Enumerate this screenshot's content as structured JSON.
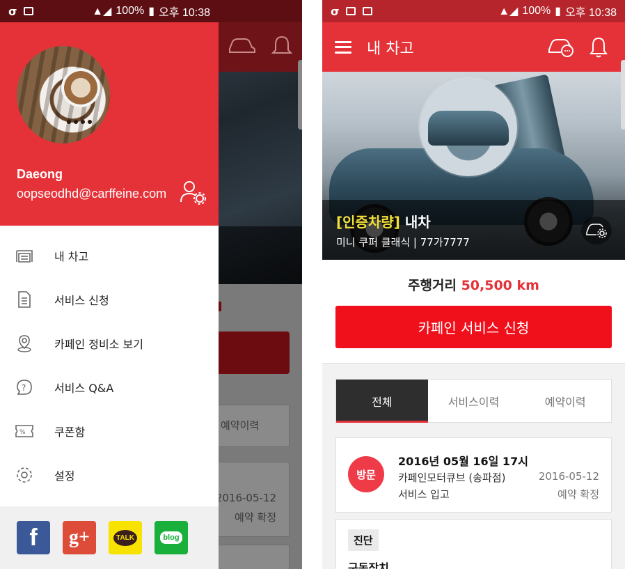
{
  "left_screen": {
    "status_bar": {
      "left_icons": [
        "carrier-icon",
        "wifi-icon"
      ],
      "battery": "100%",
      "time": "오후 10:38"
    },
    "drawer": {
      "user": {
        "name": "Daeong",
        "email": "oopseodhd@carffeine.com"
      },
      "menu": [
        {
          "label": "내 차고",
          "icon": "garage-icon"
        },
        {
          "label": "서비스 신청",
          "icon": "document-icon"
        },
        {
          "label": "카페인 정비소 보기",
          "icon": "location-pin-icon"
        },
        {
          "label": "서비스 Q&A",
          "icon": "question-bubble-icon"
        },
        {
          "label": "쿠폰함",
          "icon": "coupon-icon"
        },
        {
          "label": "설정",
          "icon": "gear-icon"
        }
      ],
      "social": [
        {
          "name": "facebook",
          "glyph": "f",
          "color": "#3b5998"
        },
        {
          "name": "google-plus",
          "glyph": "g+",
          "color": "#dd4b39"
        },
        {
          "name": "kakaotalk",
          "glyph": "TALK",
          "color": "#f7e200"
        },
        {
          "name": "blog",
          "glyph": "blog",
          "color": "#18b03a"
        }
      ]
    },
    "background_app": {
      "tab_label": "예약이력",
      "date": "2016-05-12",
      "status": "예약 확정"
    }
  },
  "right_screen": {
    "status_bar": {
      "left_icons": [
        "carrier-icon",
        "gallery-icon",
        "wifi-icon"
      ],
      "battery": "100%",
      "time": "오후 10:38"
    },
    "app_bar": {
      "title": "내 차고",
      "actions": [
        "car-menu-icon",
        "bell-icon"
      ]
    },
    "car": {
      "cert_label": "[인증차량]",
      "nickname": "내차",
      "model": "미니 쿠퍼 클래식",
      "divider": "|",
      "plate": "77가7777"
    },
    "mileage": {
      "label": "주행거리",
      "value": "50,500 km"
    },
    "service_button": "카페인 서비스 신청",
    "tabs": [
      {
        "label": "전체",
        "active": true
      },
      {
        "label": "서비스이력",
        "active": false
      },
      {
        "label": "예약이력",
        "active": false
      }
    ],
    "records": [
      {
        "badge": "방문",
        "datetime": "2016년 05월 16일 17시",
        "shop": "카페인모터큐브 (송파점)",
        "service_type": "서비스 입고",
        "date": "2016-05-12",
        "status": "예약 확정"
      }
    ],
    "diagnosis": {
      "tag": "진단",
      "category": "구동장치"
    }
  },
  "colors": {
    "brand_red": "#e53238",
    "button_red": "#f0101b",
    "dark_tab": "#2e2e2e",
    "cert_yellow": "#f2e03a"
  }
}
